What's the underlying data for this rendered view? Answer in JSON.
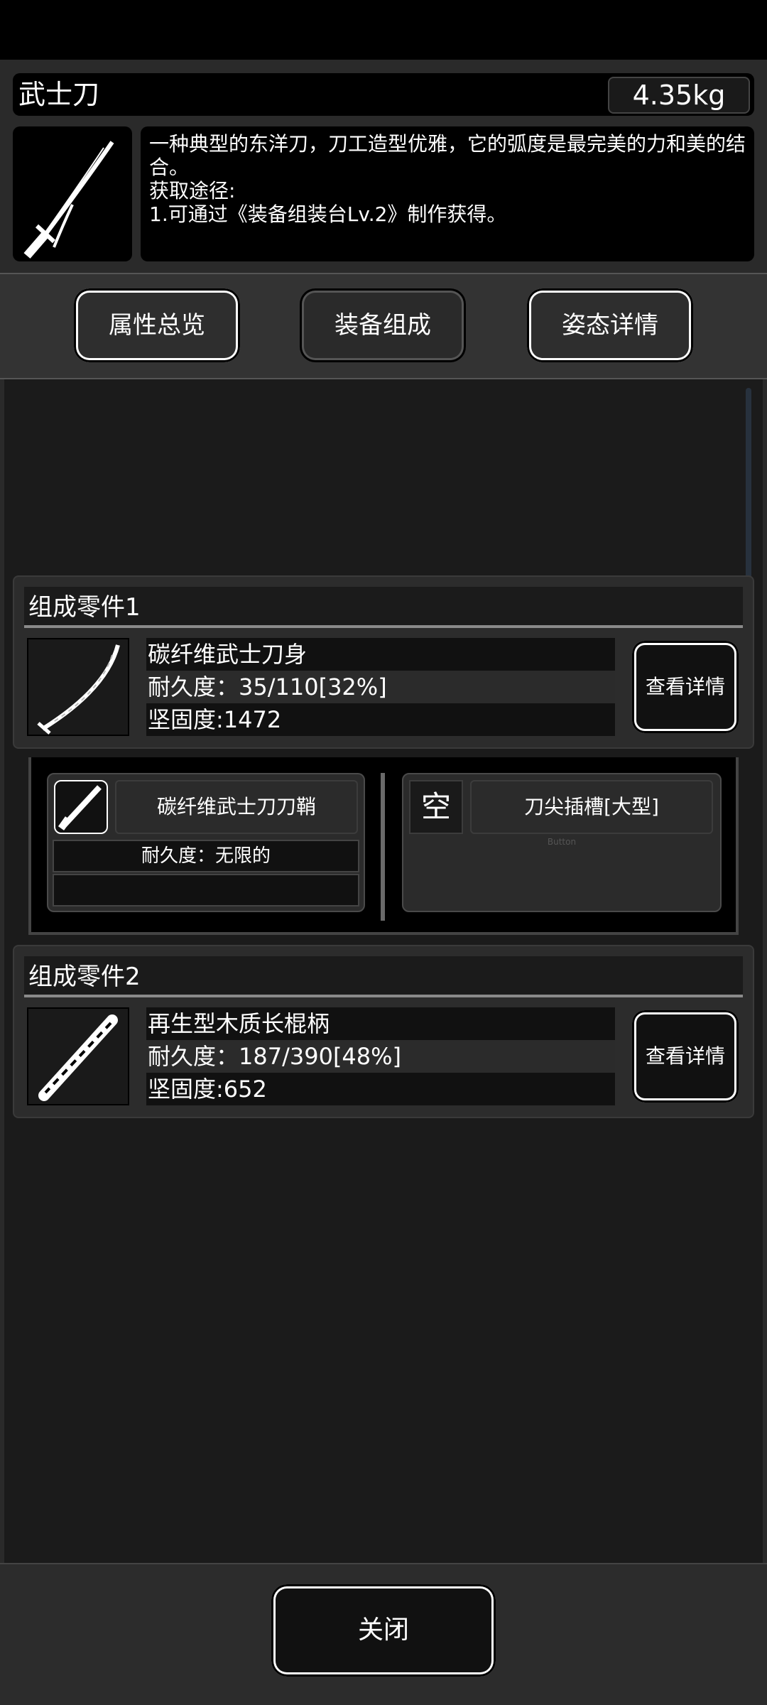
{
  "item": {
    "name": "武士刀",
    "weight": "4.35kg",
    "description": "一种典型的东洋刀，刀工造型优雅，它的弧度是最完美的力和美的结合。",
    "obtain_label": "获取途径:",
    "obtain_method": "1.可通过《装备组装台Lv.2》制作获得。"
  },
  "tabs": [
    {
      "label": "属性总览"
    },
    {
      "label": "装备组成"
    },
    {
      "label": "姿态详情"
    }
  ],
  "parts": [
    {
      "header": "组成零件1",
      "name": "碳纤维武士刀身",
      "durability": "耐久度：35/110[32%]",
      "hardness": "坚固度:1472",
      "detail_label": "查看详情",
      "icon": "blade-icon"
    },
    {
      "header": "组成零件2",
      "name": "再生型木质长棍柄",
      "durability": "耐久度：187/390[48%]",
      "hardness": "坚固度:652",
      "detail_label": "查看详情",
      "icon": "wooden-handle-icon"
    }
  ],
  "subparts": [
    {
      "name": "碳纤维武士刀刀鞘",
      "durability": "耐久度：无限的",
      "icon": "scabbard-icon"
    },
    {
      "name": "刀尖插槽[大型]",
      "empty_label": "空",
      "hint": "Button"
    }
  ],
  "footer": {
    "close_label": "关闭"
  },
  "colors": {
    "background": "#1b1b1b",
    "panel": "#2c2c2c",
    "text": "#ffffff",
    "button_border": "#ffffff"
  }
}
